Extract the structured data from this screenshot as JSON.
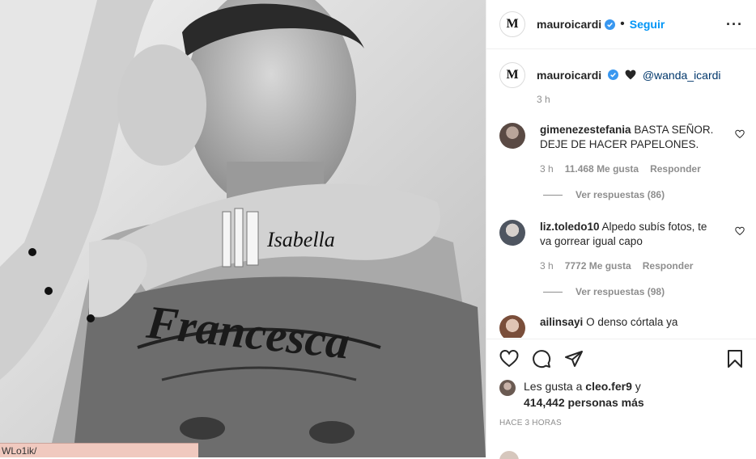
{
  "url_fragment": "WLo1ik/",
  "header": {
    "username": "mauroicardi",
    "avatar_letters": "M",
    "follow_label": "Seguir",
    "more_label": "···"
  },
  "caption": {
    "username": "mauroicardi",
    "mention": "@wanda_icardi",
    "time": "3 h"
  },
  "comments": [
    {
      "username": "gimenezestefania",
      "text": "BASTA SEÑOR. DEJE DE HACER PAPELONES.",
      "time": "3 h",
      "likes": "11.468 Me gusta",
      "reply": "Responder",
      "view_replies": "Ver respuestas (86)"
    },
    {
      "username": "liz.toledo10",
      "text": "Alpedo subís fotos, te va gorrear igual capo",
      "time": "3 h",
      "likes": "7772 Me gusta",
      "reply": "Responder",
      "view_replies": "Ver respuestas (98)"
    },
    {
      "username": "ailinsayi",
      "text": "O denso córtala ya"
    }
  ],
  "likes": {
    "prefix": "Les gusta a",
    "user": "cleo.fer9",
    "conjunction": "y",
    "count": "414,442 personas más"
  },
  "time_ago": "HACE 3 HORAS",
  "photo": {
    "tattoo_arm": "Isabella",
    "tattoo_chest": "Francesca"
  },
  "colors": {
    "accent": "#0095f6",
    "mention": "#00376b",
    "muted": "#8e8e8e"
  }
}
